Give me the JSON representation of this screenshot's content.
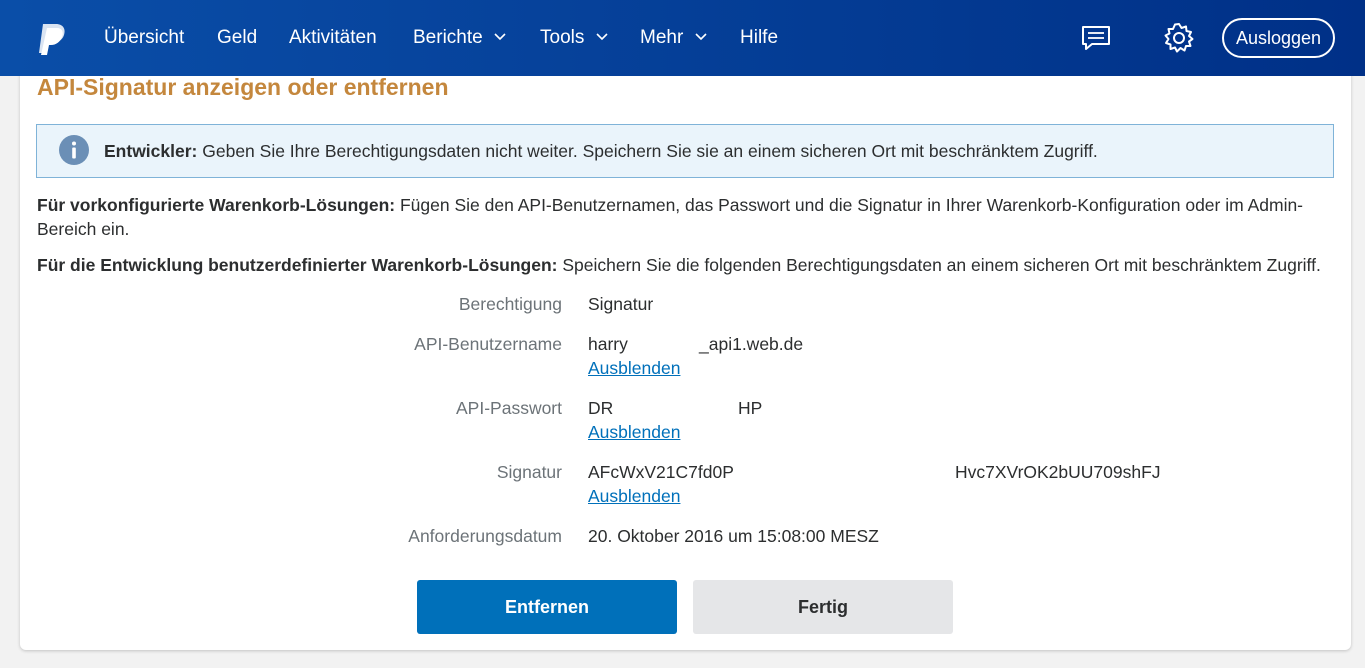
{
  "nav": {
    "items": [
      {
        "label": "Übersicht"
      },
      {
        "label": "Geld"
      },
      {
        "label": "Aktivitäten"
      },
      {
        "label": "Berichte"
      },
      {
        "label": "Tools"
      },
      {
        "label": "Mehr"
      },
      {
        "label": "Hilfe"
      }
    ],
    "logout_label": "Ausloggen",
    "icons": [
      "paypal-logo",
      "message-center-icon",
      "settings-gear-icon",
      "chevron-down-icon"
    ],
    "brand_color": "#003087"
  },
  "page": {
    "title": "API-Signatur anzeigen oder entfernen",
    "title_color": "#c4873d",
    "alert": {
      "label": "Entwickler:",
      "text": " Geben Sie Ihre Berechtigungsdaten nicht weiter. Speichern Sie sie an einem sicheren Ort mit beschränktem Zugriff."
    },
    "prebuilt": {
      "label": "Für vorkonfigurierte Warenkorb-Lösungen:",
      "text": " Fügen Sie den API-Benutzernamen, das Passwort und die Signatur in Ihrer Warenkorb-Konfiguration oder im Admin-Bereich ein."
    },
    "custom": {
      "label": "Für die Entwicklung benutzerdefinierter Warenkorb-Lösungen:",
      "text": " Speichern Sie die folgenden Berechtigungsdaten an einem sicheren Ort mit beschränktem Zugriff."
    },
    "credentials": {
      "permission_label": "Berechtigung",
      "permission_value": "Signatur",
      "username_label": "API-Benutzername",
      "username_value_start": "harry",
      "username_value_end": "_api1.web.de",
      "password_label": "API-Passwort",
      "password_value_start": "DR",
      "password_value_end": "HP",
      "signature_label": "Signatur",
      "signature_value_start": "AFcWxV21C7fd0P",
      "signature_value_end": "Hvc7XVrOK2bUU709shFJ",
      "date_label": "Anforderungsdatum",
      "date_value": "20. Oktober 2016 um 15:08:00 MESZ",
      "hide_link": "Ausblenden"
    },
    "buttons": {
      "remove": "Entfernen",
      "done": "Fertig"
    }
  }
}
